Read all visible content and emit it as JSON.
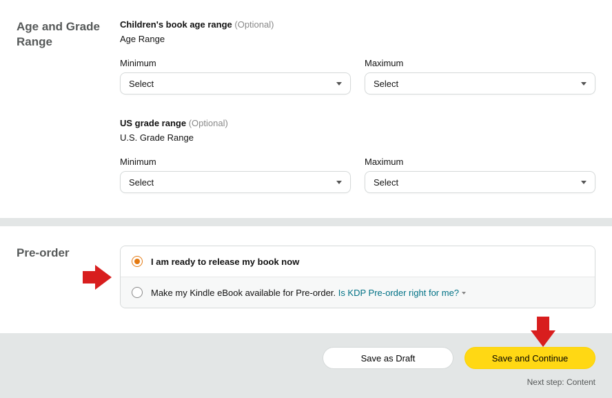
{
  "age_section": {
    "heading": "Age and Grade Range",
    "age_group_title": "Children's book age range",
    "optional": "(Optional)",
    "age_subtitle": "Age Range",
    "min_label": "Minimum",
    "max_label": "Maximum",
    "select_placeholder": "Select",
    "grade_group_title": "US grade range",
    "grade_subtitle": "U.S. Grade Range"
  },
  "preorder": {
    "heading": "Pre-order",
    "option_release_now": "I am ready to release my book now",
    "option_preorder_prefix": "Make my Kindle eBook available for Pre-order.",
    "option_preorder_link": "Is KDP Pre-order right for me?"
  },
  "footer": {
    "save_draft": "Save as Draft",
    "save_continue": "Save and Continue",
    "next_step": "Next step: Content"
  }
}
